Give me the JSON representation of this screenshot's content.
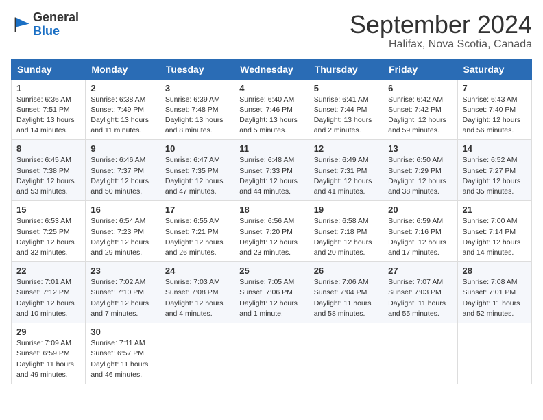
{
  "header": {
    "logo_general": "General",
    "logo_blue": "Blue",
    "month_title": "September 2024",
    "subtitle": "Halifax, Nova Scotia, Canada"
  },
  "days_of_week": [
    "Sunday",
    "Monday",
    "Tuesday",
    "Wednesday",
    "Thursday",
    "Friday",
    "Saturday"
  ],
  "weeks": [
    [
      {
        "day": "1",
        "sunrise": "Sunrise: 6:36 AM",
        "sunset": "Sunset: 7:51 PM",
        "daylight": "Daylight: 13 hours and 14 minutes."
      },
      {
        "day": "2",
        "sunrise": "Sunrise: 6:38 AM",
        "sunset": "Sunset: 7:49 PM",
        "daylight": "Daylight: 13 hours and 11 minutes."
      },
      {
        "day": "3",
        "sunrise": "Sunrise: 6:39 AM",
        "sunset": "Sunset: 7:48 PM",
        "daylight": "Daylight: 13 hours and 8 minutes."
      },
      {
        "day": "4",
        "sunrise": "Sunrise: 6:40 AM",
        "sunset": "Sunset: 7:46 PM",
        "daylight": "Daylight: 13 hours and 5 minutes."
      },
      {
        "day": "5",
        "sunrise": "Sunrise: 6:41 AM",
        "sunset": "Sunset: 7:44 PM",
        "daylight": "Daylight: 13 hours and 2 minutes."
      },
      {
        "day": "6",
        "sunrise": "Sunrise: 6:42 AM",
        "sunset": "Sunset: 7:42 PM",
        "daylight": "Daylight: 12 hours and 59 minutes."
      },
      {
        "day": "7",
        "sunrise": "Sunrise: 6:43 AM",
        "sunset": "Sunset: 7:40 PM",
        "daylight": "Daylight: 12 hours and 56 minutes."
      }
    ],
    [
      {
        "day": "8",
        "sunrise": "Sunrise: 6:45 AM",
        "sunset": "Sunset: 7:38 PM",
        "daylight": "Daylight: 12 hours and 53 minutes."
      },
      {
        "day": "9",
        "sunrise": "Sunrise: 6:46 AM",
        "sunset": "Sunset: 7:37 PM",
        "daylight": "Daylight: 12 hours and 50 minutes."
      },
      {
        "day": "10",
        "sunrise": "Sunrise: 6:47 AM",
        "sunset": "Sunset: 7:35 PM",
        "daylight": "Daylight: 12 hours and 47 minutes."
      },
      {
        "day": "11",
        "sunrise": "Sunrise: 6:48 AM",
        "sunset": "Sunset: 7:33 PM",
        "daylight": "Daylight: 12 hours and 44 minutes."
      },
      {
        "day": "12",
        "sunrise": "Sunrise: 6:49 AM",
        "sunset": "Sunset: 7:31 PM",
        "daylight": "Daylight: 12 hours and 41 minutes."
      },
      {
        "day": "13",
        "sunrise": "Sunrise: 6:50 AM",
        "sunset": "Sunset: 7:29 PM",
        "daylight": "Daylight: 12 hours and 38 minutes."
      },
      {
        "day": "14",
        "sunrise": "Sunrise: 6:52 AM",
        "sunset": "Sunset: 7:27 PM",
        "daylight": "Daylight: 12 hours and 35 minutes."
      }
    ],
    [
      {
        "day": "15",
        "sunrise": "Sunrise: 6:53 AM",
        "sunset": "Sunset: 7:25 PM",
        "daylight": "Daylight: 12 hours and 32 minutes."
      },
      {
        "day": "16",
        "sunrise": "Sunrise: 6:54 AM",
        "sunset": "Sunset: 7:23 PM",
        "daylight": "Daylight: 12 hours and 29 minutes."
      },
      {
        "day": "17",
        "sunrise": "Sunrise: 6:55 AM",
        "sunset": "Sunset: 7:21 PM",
        "daylight": "Daylight: 12 hours and 26 minutes."
      },
      {
        "day": "18",
        "sunrise": "Sunrise: 6:56 AM",
        "sunset": "Sunset: 7:20 PM",
        "daylight": "Daylight: 12 hours and 23 minutes."
      },
      {
        "day": "19",
        "sunrise": "Sunrise: 6:58 AM",
        "sunset": "Sunset: 7:18 PM",
        "daylight": "Daylight: 12 hours and 20 minutes."
      },
      {
        "day": "20",
        "sunrise": "Sunrise: 6:59 AM",
        "sunset": "Sunset: 7:16 PM",
        "daylight": "Daylight: 12 hours and 17 minutes."
      },
      {
        "day": "21",
        "sunrise": "Sunrise: 7:00 AM",
        "sunset": "Sunset: 7:14 PM",
        "daylight": "Daylight: 12 hours and 14 minutes."
      }
    ],
    [
      {
        "day": "22",
        "sunrise": "Sunrise: 7:01 AM",
        "sunset": "Sunset: 7:12 PM",
        "daylight": "Daylight: 12 hours and 10 minutes."
      },
      {
        "day": "23",
        "sunrise": "Sunrise: 7:02 AM",
        "sunset": "Sunset: 7:10 PM",
        "daylight": "Daylight: 12 hours and 7 minutes."
      },
      {
        "day": "24",
        "sunrise": "Sunrise: 7:03 AM",
        "sunset": "Sunset: 7:08 PM",
        "daylight": "Daylight: 12 hours and 4 minutes."
      },
      {
        "day": "25",
        "sunrise": "Sunrise: 7:05 AM",
        "sunset": "Sunset: 7:06 PM",
        "daylight": "Daylight: 12 hours and 1 minute."
      },
      {
        "day": "26",
        "sunrise": "Sunrise: 7:06 AM",
        "sunset": "Sunset: 7:04 PM",
        "daylight": "Daylight: 11 hours and 58 minutes."
      },
      {
        "day": "27",
        "sunrise": "Sunrise: 7:07 AM",
        "sunset": "Sunset: 7:03 PM",
        "daylight": "Daylight: 11 hours and 55 minutes."
      },
      {
        "day": "28",
        "sunrise": "Sunrise: 7:08 AM",
        "sunset": "Sunset: 7:01 PM",
        "daylight": "Daylight: 11 hours and 52 minutes."
      }
    ],
    [
      {
        "day": "29",
        "sunrise": "Sunrise: 7:09 AM",
        "sunset": "Sunset: 6:59 PM",
        "daylight": "Daylight: 11 hours and 49 minutes."
      },
      {
        "day": "30",
        "sunrise": "Sunrise: 7:11 AM",
        "sunset": "Sunset: 6:57 PM",
        "daylight": "Daylight: 11 hours and 46 minutes."
      },
      null,
      null,
      null,
      null,
      null
    ]
  ]
}
